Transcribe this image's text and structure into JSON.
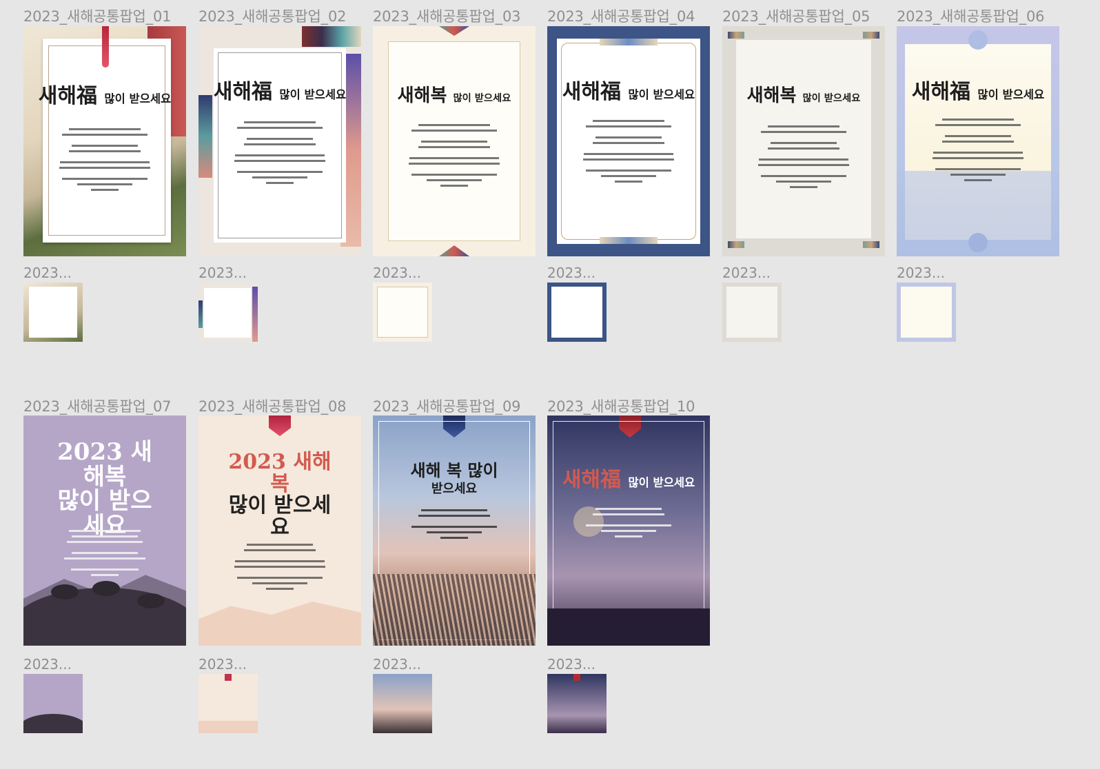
{
  "popups": [
    {
      "name": "2023_새해공통팝업_01",
      "title": "새해福",
      "sub": "많이 받으세요",
      "theme": "silk"
    },
    {
      "name": "2023_새해공통팝업_02",
      "title": "새해福",
      "sub": "많이 받으세요",
      "theme": "geo"
    },
    {
      "name": "2023_새해공통팝업_03",
      "title": "새해복",
      "sub": "많이 받으세요",
      "theme": "cream"
    },
    {
      "name": "2023_새해공통팝업_04",
      "title": "새해福",
      "sub": "많이 받으세요",
      "theme": "navy"
    },
    {
      "name": "2023_새해공통팝업_05",
      "title": "새해복",
      "sub": "많이 받으세요",
      "theme": "hanji"
    },
    {
      "name": "2023_새해공통팝업_06",
      "title": "새해福",
      "sub": "많이 받으세요",
      "theme": "pastel"
    },
    {
      "name": "2023_새해공통팝업_07",
      "title": "2023 새해복",
      "sub": "많이 받으세요",
      "theme": "rabbit"
    },
    {
      "name": "2023_새해공통팝업_08",
      "title": "2023 새해복",
      "sub": "많이 받으세요",
      "theme": "peach"
    },
    {
      "name": "2023_새해공통팝업_09",
      "title": "새해 복 많이",
      "sub": "받으세요",
      "theme": "reeds"
    },
    {
      "name": "2023_새해공통팝업_10",
      "title": "새해福",
      "sub": "많이 받으세요",
      "theme": "night"
    }
  ],
  "thumb_label": "2023...",
  "colors": {
    "background": "#e6e6e6",
    "label": "#8f8f8f",
    "accent_red": "#d25a4f",
    "navy": "#3c5486",
    "lavender": "#b9bfe0"
  }
}
